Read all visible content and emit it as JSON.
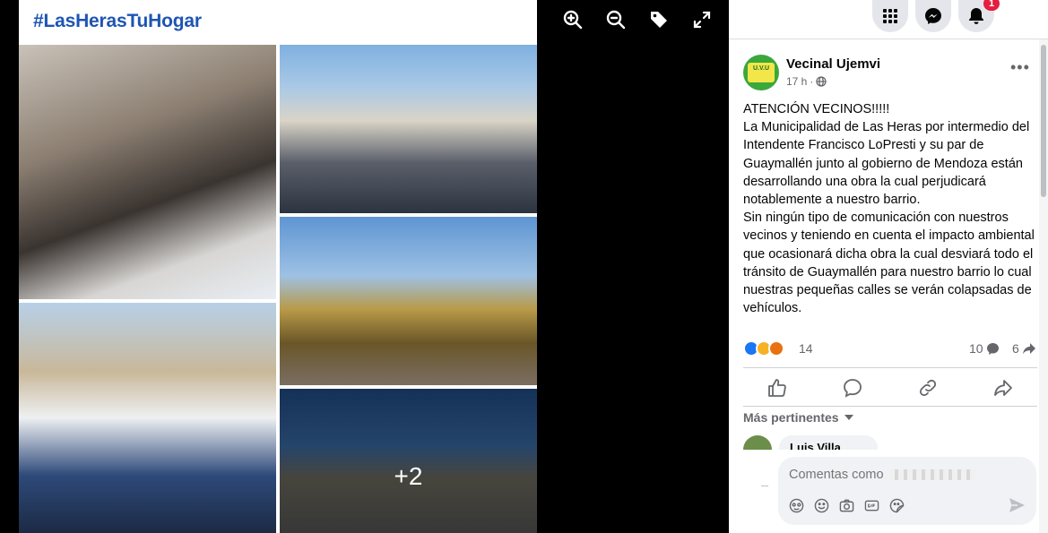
{
  "viewer": {
    "hashtag": "#LasHerasTuHogar",
    "more_photos": "+2",
    "toolbar": [
      "zoom-in-icon",
      "zoom-out-icon",
      "tag-icon",
      "fullscreen-icon"
    ]
  },
  "header": {
    "notification_badge": "1"
  },
  "post": {
    "author": "Vecinal Ujemvi",
    "avatar_text": "U.V.U",
    "time": "17 h",
    "audience": "public",
    "text": "ATENCIÓN VECINOS!!!!!\nLa Municipalidad de Las Heras por intermedio del Intendente Francisco LoPresti y su par de Guaymallén junto al gobierno de Mendoza están desarrollando una obra la cual perjudicará notablemente a nuestro barrio.\nSin ningún tipo de comunicación con nuestros vecinos y teniendo en cuenta el impacto ambiental que ocasionará dicha obra la cual desviará todo el tránsito de Guaymallén para nuestro barrio lo cual nuestras pequeñas calles se verán colapsadas de vehículos.",
    "reactions_count": "14",
    "comments_count": "10",
    "shares_count": "6"
  },
  "comments": {
    "filter_label": "Más pertinentes",
    "first_commenter": "Luis Villa"
  },
  "composer": {
    "placeholder": "Comentas como"
  },
  "colors": {
    "brand_blue": "#1877f2",
    "hashtag_blue": "#1e55b3",
    "badge_red": "#e41e3f"
  }
}
